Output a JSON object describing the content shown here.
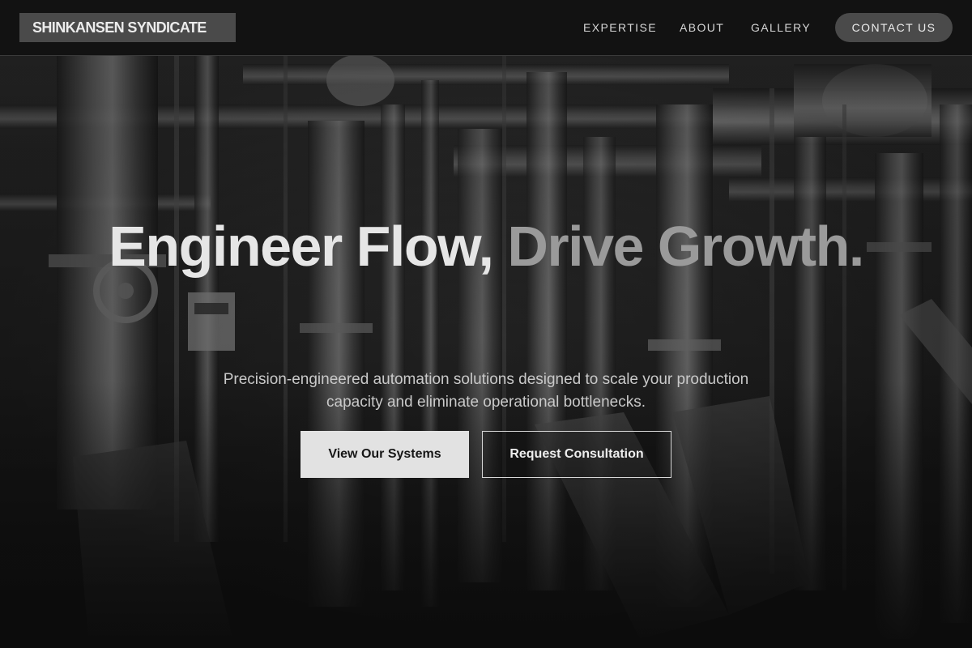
{
  "header": {
    "logo_text": "SHINKANSEN SYNDICATE",
    "nav": {
      "expertise": "EXPERTISE",
      "about": "ABOUT",
      "gallery": "GALLERY"
    },
    "cta_label": "CONTACT US"
  },
  "hero": {
    "title_part1": "Engineer Flow, ",
    "title_part2": "Drive Growth.",
    "subtitle": "Precision-engineered automation solutions designed to scale your production capacity and eliminate operational bottlenecks.",
    "primary_button": "View Our Systems",
    "secondary_button": "Request Consultation",
    "background": "grayscale industrial pipework photo"
  },
  "colors": {
    "page_background": "#141414",
    "header_background": "#121212",
    "logo_background": "#4a4a4a",
    "title_text": "#e6e6e6",
    "title_accent_dim": "#9a9a9a",
    "primary_button_bg": "#e2e2e2"
  }
}
